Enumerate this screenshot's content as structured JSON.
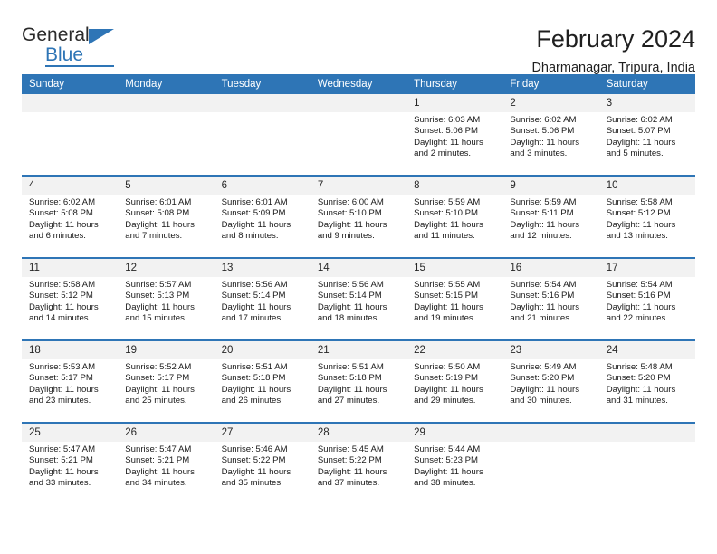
{
  "logo": {
    "word_top": "General",
    "word_bottom": "Blue",
    "triangle_color": "#2E75B6",
    "text_color": "#2b2b2b"
  },
  "header": {
    "title": "February 2024",
    "subtitle": "Dharmanagar, Tripura, India"
  },
  "theme": {
    "header_blue": "#2E75B6",
    "daynum_bg": "#f2f2f2",
    "text": "#1a1a1a"
  },
  "weekdays": [
    "Sunday",
    "Monday",
    "Tuesday",
    "Wednesday",
    "Thursday",
    "Friday",
    "Saturday"
  ],
  "weeks": [
    [
      {
        "day": "",
        "empty": true
      },
      {
        "day": "",
        "empty": true
      },
      {
        "day": "",
        "empty": true
      },
      {
        "day": "",
        "empty": true
      },
      {
        "day": "1",
        "sunrise": "Sunrise: 6:03 AM",
        "sunset": "Sunset: 5:06 PM",
        "daylight": "Daylight: 11 hours and 2 minutes."
      },
      {
        "day": "2",
        "sunrise": "Sunrise: 6:02 AM",
        "sunset": "Sunset: 5:06 PM",
        "daylight": "Daylight: 11 hours and 3 minutes."
      },
      {
        "day": "3",
        "sunrise": "Sunrise: 6:02 AM",
        "sunset": "Sunset: 5:07 PM",
        "daylight": "Daylight: 11 hours and 5 minutes."
      }
    ],
    [
      {
        "day": "4",
        "sunrise": "Sunrise: 6:02 AM",
        "sunset": "Sunset: 5:08 PM",
        "daylight": "Daylight: 11 hours and 6 minutes."
      },
      {
        "day": "5",
        "sunrise": "Sunrise: 6:01 AM",
        "sunset": "Sunset: 5:08 PM",
        "daylight": "Daylight: 11 hours and 7 minutes."
      },
      {
        "day": "6",
        "sunrise": "Sunrise: 6:01 AM",
        "sunset": "Sunset: 5:09 PM",
        "daylight": "Daylight: 11 hours and 8 minutes."
      },
      {
        "day": "7",
        "sunrise": "Sunrise: 6:00 AM",
        "sunset": "Sunset: 5:10 PM",
        "daylight": "Daylight: 11 hours and 9 minutes."
      },
      {
        "day": "8",
        "sunrise": "Sunrise: 5:59 AM",
        "sunset": "Sunset: 5:10 PM",
        "daylight": "Daylight: 11 hours and 11 minutes."
      },
      {
        "day": "9",
        "sunrise": "Sunrise: 5:59 AM",
        "sunset": "Sunset: 5:11 PM",
        "daylight": "Daylight: 11 hours and 12 minutes."
      },
      {
        "day": "10",
        "sunrise": "Sunrise: 5:58 AM",
        "sunset": "Sunset: 5:12 PM",
        "daylight": "Daylight: 11 hours and 13 minutes."
      }
    ],
    [
      {
        "day": "11",
        "sunrise": "Sunrise: 5:58 AM",
        "sunset": "Sunset: 5:12 PM",
        "daylight": "Daylight: 11 hours and 14 minutes."
      },
      {
        "day": "12",
        "sunrise": "Sunrise: 5:57 AM",
        "sunset": "Sunset: 5:13 PM",
        "daylight": "Daylight: 11 hours and 15 minutes."
      },
      {
        "day": "13",
        "sunrise": "Sunrise: 5:56 AM",
        "sunset": "Sunset: 5:14 PM",
        "daylight": "Daylight: 11 hours and 17 minutes."
      },
      {
        "day": "14",
        "sunrise": "Sunrise: 5:56 AM",
        "sunset": "Sunset: 5:14 PM",
        "daylight": "Daylight: 11 hours and 18 minutes."
      },
      {
        "day": "15",
        "sunrise": "Sunrise: 5:55 AM",
        "sunset": "Sunset: 5:15 PM",
        "daylight": "Daylight: 11 hours and 19 minutes."
      },
      {
        "day": "16",
        "sunrise": "Sunrise: 5:54 AM",
        "sunset": "Sunset: 5:16 PM",
        "daylight": "Daylight: 11 hours and 21 minutes."
      },
      {
        "day": "17",
        "sunrise": "Sunrise: 5:54 AM",
        "sunset": "Sunset: 5:16 PM",
        "daylight": "Daylight: 11 hours and 22 minutes."
      }
    ],
    [
      {
        "day": "18",
        "sunrise": "Sunrise: 5:53 AM",
        "sunset": "Sunset: 5:17 PM",
        "daylight": "Daylight: 11 hours and 23 minutes."
      },
      {
        "day": "19",
        "sunrise": "Sunrise: 5:52 AM",
        "sunset": "Sunset: 5:17 PM",
        "daylight": "Daylight: 11 hours and 25 minutes."
      },
      {
        "day": "20",
        "sunrise": "Sunrise: 5:51 AM",
        "sunset": "Sunset: 5:18 PM",
        "daylight": "Daylight: 11 hours and 26 minutes."
      },
      {
        "day": "21",
        "sunrise": "Sunrise: 5:51 AM",
        "sunset": "Sunset: 5:18 PM",
        "daylight": "Daylight: 11 hours and 27 minutes."
      },
      {
        "day": "22",
        "sunrise": "Sunrise: 5:50 AM",
        "sunset": "Sunset: 5:19 PM",
        "daylight": "Daylight: 11 hours and 29 minutes."
      },
      {
        "day": "23",
        "sunrise": "Sunrise: 5:49 AM",
        "sunset": "Sunset: 5:20 PM",
        "daylight": "Daylight: 11 hours and 30 minutes."
      },
      {
        "day": "24",
        "sunrise": "Sunrise: 5:48 AM",
        "sunset": "Sunset: 5:20 PM",
        "daylight": "Daylight: 11 hours and 31 minutes."
      }
    ],
    [
      {
        "day": "25",
        "sunrise": "Sunrise: 5:47 AM",
        "sunset": "Sunset: 5:21 PM",
        "daylight": "Daylight: 11 hours and 33 minutes."
      },
      {
        "day": "26",
        "sunrise": "Sunrise: 5:47 AM",
        "sunset": "Sunset: 5:21 PM",
        "daylight": "Daylight: 11 hours and 34 minutes."
      },
      {
        "day": "27",
        "sunrise": "Sunrise: 5:46 AM",
        "sunset": "Sunset: 5:22 PM",
        "daylight": "Daylight: 11 hours and 35 minutes."
      },
      {
        "day": "28",
        "sunrise": "Sunrise: 5:45 AM",
        "sunset": "Sunset: 5:22 PM",
        "daylight": "Daylight: 11 hours and 37 minutes."
      },
      {
        "day": "29",
        "sunrise": "Sunrise: 5:44 AM",
        "sunset": "Sunset: 5:23 PM",
        "daylight": "Daylight: 11 hours and 38 minutes."
      },
      {
        "day": "",
        "empty": true
      },
      {
        "day": "",
        "empty": true
      }
    ]
  ]
}
